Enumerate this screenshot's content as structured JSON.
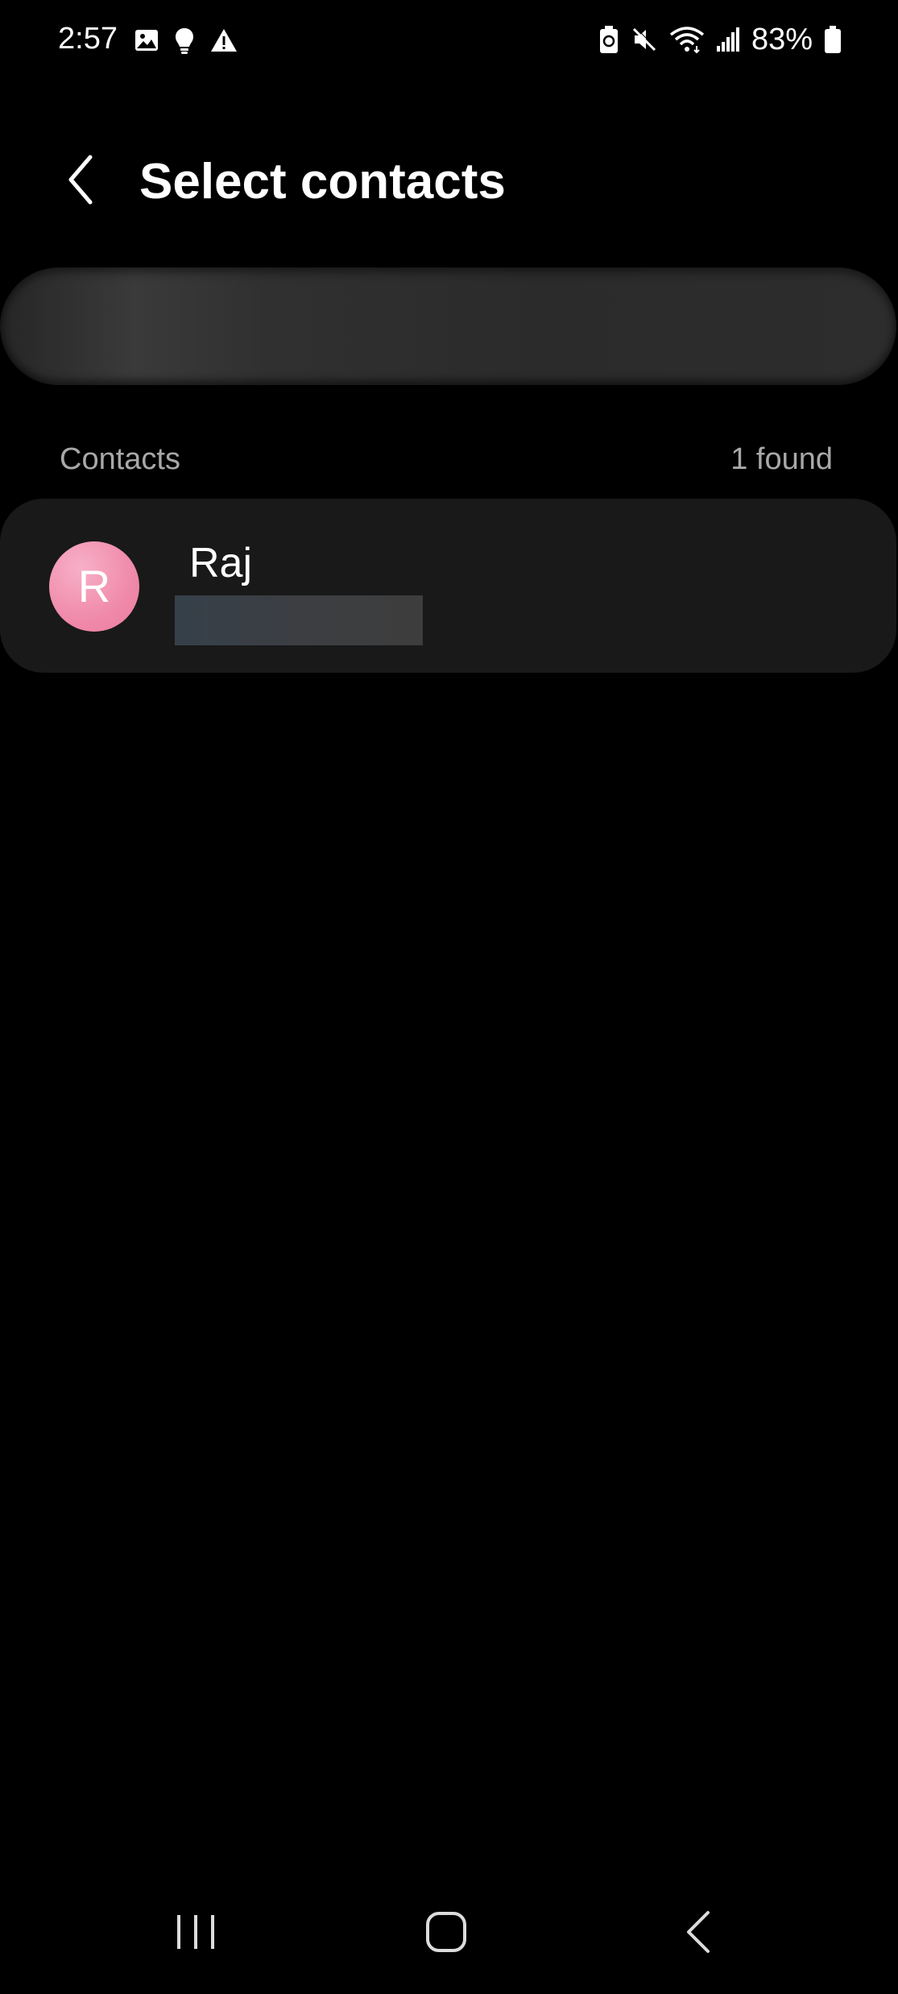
{
  "status_bar": {
    "time": "2:57",
    "battery": "83%",
    "left_icons": [
      "image-icon",
      "lightbulb-icon",
      "warning-icon"
    ],
    "right_icons": [
      "battery-saver-icon",
      "mute-icon",
      "wifi-icon",
      "signal-icon",
      "battery-icon"
    ]
  },
  "header": {
    "title": "Select contacts",
    "back_icon": "chevron-left-icon"
  },
  "section": {
    "label": "Contacts",
    "count": "1 found"
  },
  "contacts": [
    {
      "initial": "R",
      "name": "Raj",
      "avatar_color": "#f08aaa"
    }
  ],
  "nav_bar": {
    "icons": [
      "recents-icon",
      "home-icon",
      "back-icon"
    ]
  },
  "colors": {
    "background": "#000000",
    "card": "#191919",
    "secondary_text": "#a8a8a8"
  }
}
